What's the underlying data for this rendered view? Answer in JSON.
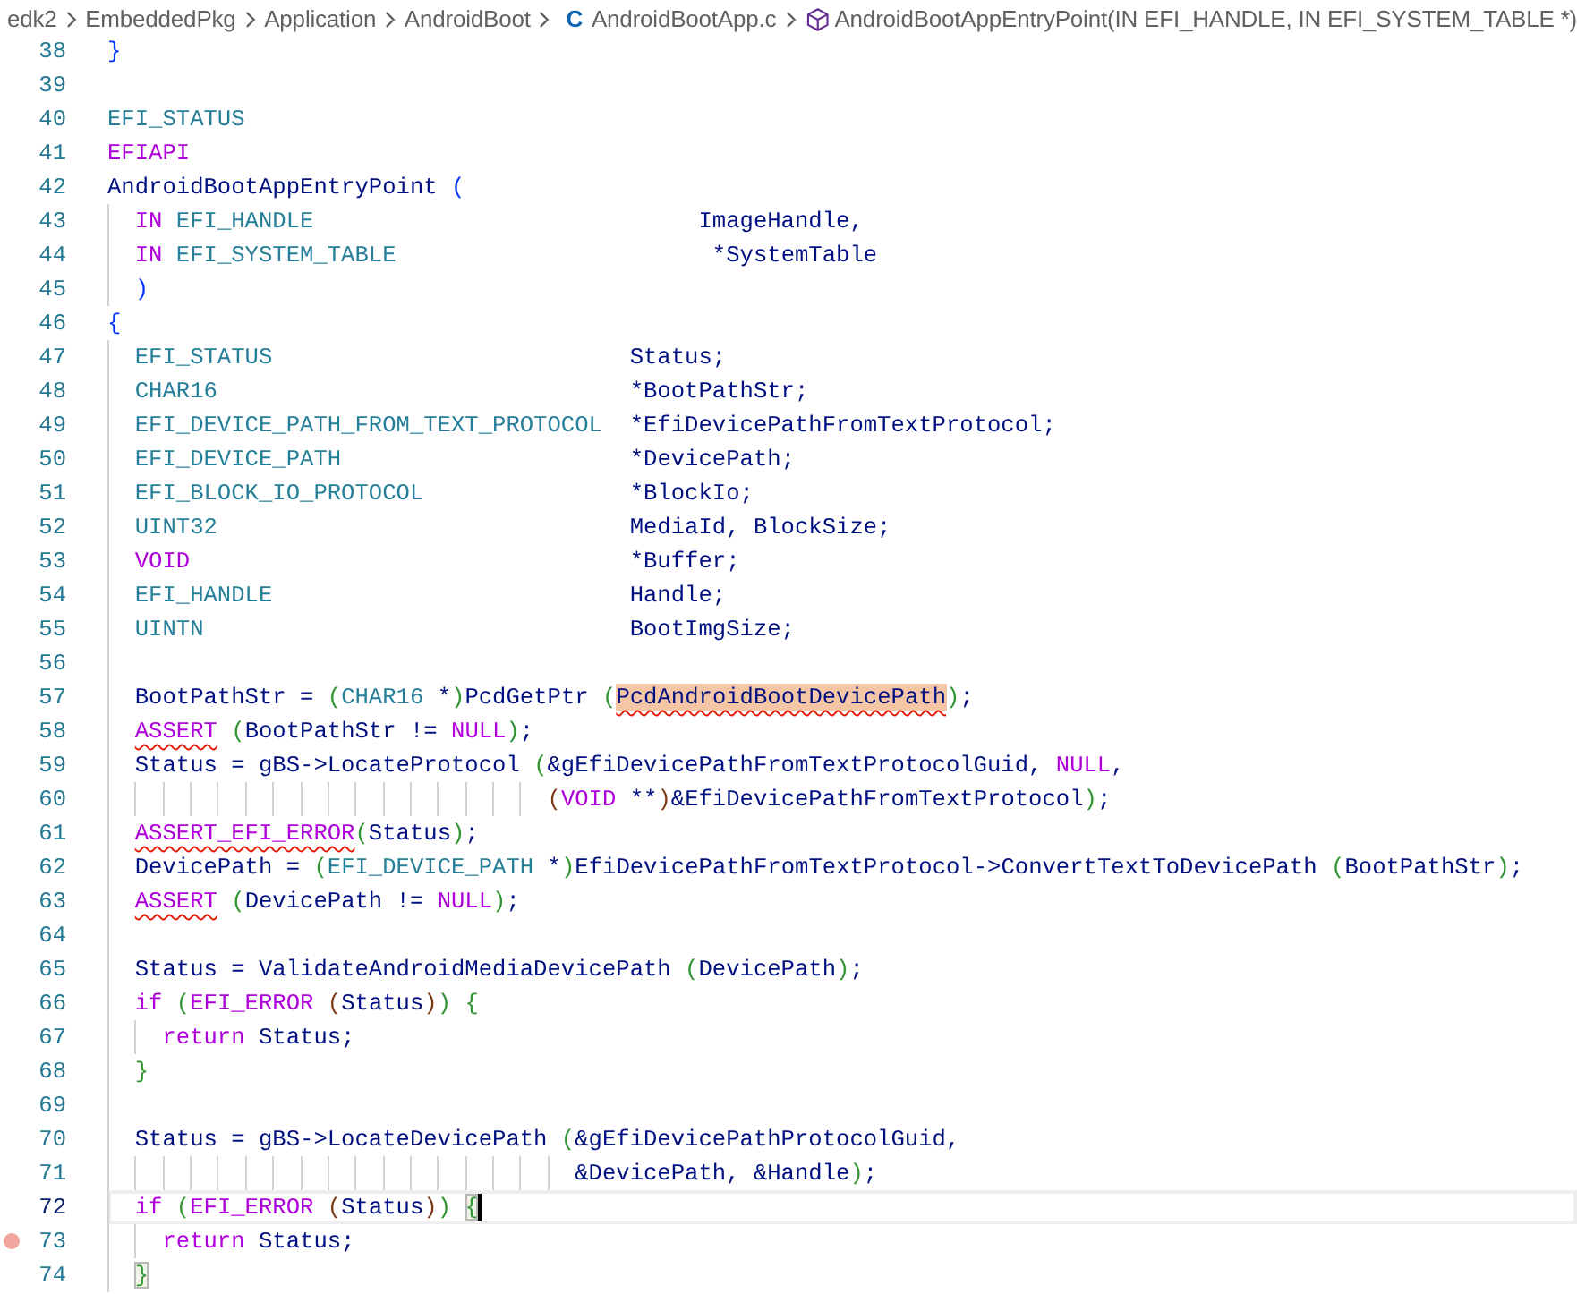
{
  "breadcrumb": [
    {
      "kind": "folder",
      "label": "edk2"
    },
    {
      "kind": "folder",
      "label": "EmbeddedPkg"
    },
    {
      "kind": "folder",
      "label": "Application"
    },
    {
      "kind": "folder",
      "label": "AndroidBoot"
    },
    {
      "kind": "file",
      "label": "AndroidBootApp.c",
      "badge": "C"
    },
    {
      "kind": "symbol",
      "label": "AndroidBootAppEntryPoint(IN EFI_HANDLE, IN EFI_SYSTEM_TABLE *)"
    }
  ],
  "lines": [
    {
      "number": "38",
      "current": false,
      "breakpoint": false,
      "tokens": [
        {
          "kind": "p1",
          "t": "}"
        }
      ]
    },
    {
      "number": "39",
      "current": false,
      "breakpoint": false
    },
    {
      "number": "40",
      "current": false,
      "breakpoint": false,
      "tokens": [
        {
          "kind": "type",
          "t": "EFI_STATUS"
        }
      ]
    },
    {
      "number": "41",
      "current": false,
      "breakpoint": false,
      "tokens": [
        {
          "kind": "kw",
          "t": "EFIAPI"
        }
      ]
    },
    {
      "number": "42",
      "current": false,
      "breakpoint": false,
      "tokens": [
        {
          "kind": "id",
          "t": "AndroidBootAppEntryPoint "
        },
        {
          "kind": "p1",
          "t": "("
        }
      ]
    },
    {
      "number": "43",
      "current": false,
      "breakpoint": false,
      "tokens": [
        {
          "kind": "kw",
          "t": "  IN"
        },
        {
          "kind": "type",
          "t": " EFI_HANDLE"
        },
        {
          "kind": "id",
          "t": "                            ImageHandle,"
        }
      ]
    },
    {
      "number": "44",
      "current": false,
      "breakpoint": false,
      "tokens": [
        {
          "kind": "kw",
          "t": "  IN"
        },
        {
          "kind": "type",
          "t": " EFI_SYSTEM_TABLE"
        },
        {
          "kind": "id",
          "t": "                       *SystemTable"
        }
      ]
    },
    {
      "number": "45",
      "current": false,
      "breakpoint": false,
      "tokens": [
        {
          "kind": "p1",
          "t": "  )"
        }
      ]
    },
    {
      "number": "46",
      "current": false,
      "breakpoint": false,
      "tokens": [
        {
          "kind": "p1",
          "t": "{"
        }
      ]
    },
    {
      "number": "47",
      "current": false,
      "breakpoint": false,
      "tokens": [
        {
          "kind": "type",
          "t": "  EFI_STATUS"
        },
        {
          "kind": "id",
          "t": "                          Status;"
        }
      ]
    },
    {
      "number": "48",
      "current": false,
      "breakpoint": false,
      "tokens": [
        {
          "kind": "type",
          "t": "  CHAR16"
        },
        {
          "kind": "id",
          "t": "                              *BootPathStr;"
        }
      ]
    },
    {
      "number": "49",
      "current": false,
      "breakpoint": false,
      "tokens": [
        {
          "kind": "type",
          "t": "  EFI_DEVICE_PATH_FROM_TEXT_PROTOCOL"
        },
        {
          "kind": "id",
          "t": "  *EfiDevicePathFromTextProtocol;"
        }
      ]
    },
    {
      "number": "50",
      "current": false,
      "breakpoint": false,
      "tokens": [
        {
          "kind": "type",
          "t": "  EFI_DEVICE_PATH"
        },
        {
          "kind": "id",
          "t": "                     *DevicePath;"
        }
      ]
    },
    {
      "number": "51",
      "current": false,
      "breakpoint": false,
      "tokens": [
        {
          "kind": "type",
          "t": "  EFI_BLOCK_IO_PROTOCOL"
        },
        {
          "kind": "id",
          "t": "               *BlockIo;"
        }
      ]
    },
    {
      "number": "52",
      "current": false,
      "breakpoint": false,
      "tokens": [
        {
          "kind": "type",
          "t": "  UINT32"
        },
        {
          "kind": "id",
          "t": "                              MediaId, BlockSize;"
        }
      ]
    },
    {
      "number": "53",
      "current": false,
      "breakpoint": false,
      "tokens": [
        {
          "kind": "kw",
          "t": "  VOID"
        },
        {
          "kind": "id",
          "t": "                                *Buffer;"
        }
      ]
    },
    {
      "number": "54",
      "current": false,
      "breakpoint": false,
      "tokens": [
        {
          "kind": "type",
          "t": "  EFI_HANDLE"
        },
        {
          "kind": "id",
          "t": "                          Handle;"
        }
      ]
    },
    {
      "number": "55",
      "current": false,
      "breakpoint": false,
      "tokens": [
        {
          "kind": "type",
          "t": "  UINTN"
        },
        {
          "kind": "id",
          "t": "                               BootImgSize;"
        }
      ]
    },
    {
      "number": "56",
      "current": false,
      "breakpoint": false
    },
    {
      "number": "57",
      "current": false,
      "breakpoint": false,
      "tokens": [
        {
          "kind": "id",
          "t": "  BootPathStr = "
        },
        {
          "kind": "p2",
          "t": "("
        },
        {
          "kind": "type",
          "t": "CHAR16"
        },
        {
          "kind": "id",
          "t": " *"
        },
        {
          "kind": "p2",
          "t": ")"
        },
        {
          "kind": "id",
          "t": "PcdGetPtr "
        },
        {
          "kind": "p2",
          "t": "("
        },
        {
          "kind": "found",
          "t": "PcdAndroidBootDevicePath"
        },
        {
          "kind": "p2",
          "t": ")"
        },
        {
          "kind": "id",
          "t": ";"
        }
      ]
    },
    {
      "number": "58",
      "current": false,
      "breakpoint": false,
      "tokens": [
        {
          "kind": "kwerr",
          "t": "  ASSERT"
        },
        {
          "kind": "p2",
          "t": " ("
        },
        {
          "kind": "id",
          "t": "BootPathStr != "
        },
        {
          "kind": "kw",
          "t": "NULL"
        },
        {
          "kind": "p2",
          "t": ")"
        },
        {
          "kind": "id",
          "t": ";"
        }
      ]
    },
    {
      "number": "59",
      "current": false,
      "breakpoint": false,
      "tokens": [
        {
          "kind": "id",
          "t": "  Status = gBS->LocateProtocol "
        },
        {
          "kind": "p2",
          "t": "("
        },
        {
          "kind": "id",
          "t": "&gEfiDevicePathFromTextProtocolGuid, "
        },
        {
          "kind": "kw",
          "t": "NULL"
        },
        {
          "kind": "id",
          "t": ","
        }
      ]
    },
    {
      "number": "60",
      "current": false,
      "breakpoint": false,
      "tokens": [
        {
          "kind": "p3",
          "t": "                                ("
        },
        {
          "kind": "kw",
          "t": "VOID"
        },
        {
          "kind": "id",
          "t": " **"
        },
        {
          "kind": "p3",
          "t": ")"
        },
        {
          "kind": "id",
          "t": "&EfiDevicePathFromTextProtocol"
        },
        {
          "kind": "p2",
          "t": ")"
        },
        {
          "kind": "id",
          "t": ";"
        }
      ]
    },
    {
      "number": "61",
      "current": false,
      "breakpoint": false,
      "tokens": [
        {
          "kind": "kwerr",
          "t": "  ASSERT_EFI_ERROR"
        },
        {
          "kind": "p2",
          "t": "("
        },
        {
          "kind": "id",
          "t": "Status"
        },
        {
          "kind": "p2",
          "t": ")"
        },
        {
          "kind": "id",
          "t": ";"
        }
      ]
    },
    {
      "number": "62",
      "current": false,
      "breakpoint": false,
      "tokens": [
        {
          "kind": "id",
          "t": "  DevicePath = "
        },
        {
          "kind": "p2",
          "t": "("
        },
        {
          "kind": "type",
          "t": "EFI_DEVICE_PATH"
        },
        {
          "kind": "id",
          "t": " *"
        },
        {
          "kind": "p2",
          "t": ")"
        },
        {
          "kind": "id",
          "t": "EfiDevicePathFromTextProtocol->ConvertTextToDevicePath "
        },
        {
          "kind": "p2",
          "t": "("
        },
        {
          "kind": "id",
          "t": "BootPathStr"
        },
        {
          "kind": "p2",
          "t": ")"
        },
        {
          "kind": "id",
          "t": ";"
        }
      ]
    },
    {
      "number": "63",
      "current": false,
      "breakpoint": false,
      "tokens": [
        {
          "kind": "kwerr",
          "t": "  ASSERT"
        },
        {
          "kind": "p2",
          "t": " ("
        },
        {
          "kind": "id",
          "t": "DevicePath != "
        },
        {
          "kind": "kw",
          "t": "NULL"
        },
        {
          "kind": "p2",
          "t": ")"
        },
        {
          "kind": "id",
          "t": ";"
        }
      ]
    },
    {
      "number": "64",
      "current": false,
      "breakpoint": false
    },
    {
      "number": "65",
      "current": false,
      "breakpoint": false,
      "tokens": [
        {
          "kind": "id",
          "t": "  Status = ValidateAndroidMediaDevicePath "
        },
        {
          "kind": "p2",
          "t": "("
        },
        {
          "kind": "id",
          "t": "DevicePath"
        },
        {
          "kind": "p2",
          "t": ")"
        },
        {
          "kind": "id",
          "t": ";"
        }
      ]
    },
    {
      "number": "66",
      "current": false,
      "breakpoint": false,
      "tokens": [
        {
          "kind": "kw",
          "t": "  if"
        },
        {
          "kind": "p2",
          "t": " ("
        },
        {
          "kind": "kw",
          "t": "EFI_ERROR"
        },
        {
          "kind": "p3",
          "t": " ("
        },
        {
          "kind": "id",
          "t": "Status"
        },
        {
          "kind": "p3",
          "t": ")"
        },
        {
          "kind": "p2",
          "t": ")"
        },
        {
          "kind": "p2",
          "t": " {"
        }
      ]
    },
    {
      "number": "67",
      "current": false,
      "breakpoint": false,
      "tokens": [
        {
          "kind": "kw",
          "t": "    return"
        },
        {
          "kind": "id",
          "t": " Status;"
        }
      ]
    },
    {
      "number": "68",
      "current": false,
      "breakpoint": false,
      "tokens": [
        {
          "kind": "p2",
          "t": "  }"
        }
      ]
    },
    {
      "number": "69",
      "current": false,
      "breakpoint": false
    },
    {
      "number": "70",
      "current": false,
      "breakpoint": false,
      "tokens": [
        {
          "kind": "id",
          "t": "  Status = gBS->LocateDevicePath "
        },
        {
          "kind": "p2",
          "t": "("
        },
        {
          "kind": "id",
          "t": "&gEfiDevicePathProtocolGuid,"
        }
      ]
    },
    {
      "number": "71",
      "current": false,
      "breakpoint": false,
      "tokens": [
        {
          "kind": "id",
          "t": "                                  &DevicePath, &Handle"
        },
        {
          "kind": "p2",
          "t": ")"
        },
        {
          "kind": "id",
          "t": ";"
        }
      ]
    },
    {
      "number": "72",
      "current": true,
      "breakpoint": false,
      "tokens": [
        {
          "kind": "kw",
          "t": "  if"
        },
        {
          "kind": "p2",
          "t": " ("
        },
        {
          "kind": "kw",
          "t": "EFI_ERROR"
        },
        {
          "kind": "p3",
          "t": " ("
        },
        {
          "kind": "id",
          "t": "Status"
        },
        {
          "kind": "p3",
          "t": ")"
        },
        {
          "kind": "p2",
          "t": ")"
        },
        {
          "kind": "match",
          "t": " {"
        }
      ]
    },
    {
      "number": "73",
      "current": false,
      "breakpoint": true,
      "tokens": [
        {
          "kind": "kw",
          "t": "    return"
        },
        {
          "kind": "id",
          "t": " Status;"
        }
      ]
    },
    {
      "number": "74",
      "current": false,
      "breakpoint": false,
      "tokens": [
        {
          "kind": "match",
          "t": "  }"
        }
      ]
    }
  ]
}
